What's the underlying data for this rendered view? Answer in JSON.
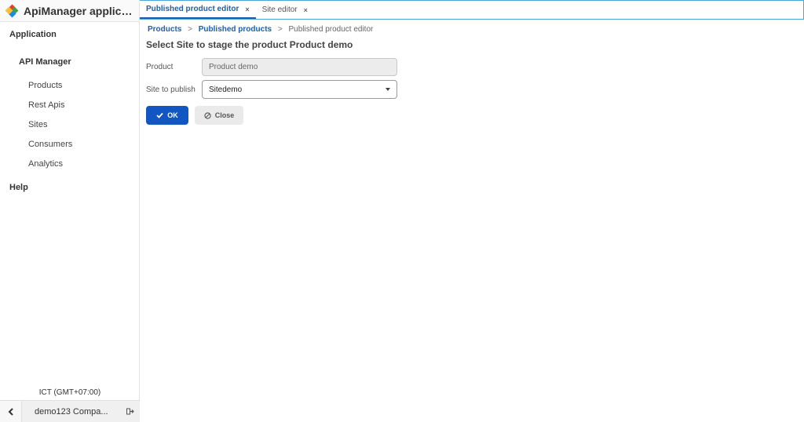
{
  "app": {
    "title": "ApiManager applicati...",
    "logo_colors": [
      "#e53935",
      "#43a047",
      "#1e88e5",
      "#fbc02d"
    ]
  },
  "sidebar": {
    "group_application": "Application",
    "group_api_manager": "API Manager",
    "items": [
      {
        "label": "Products"
      },
      {
        "label": "Rest Apis"
      },
      {
        "label": "Sites"
      },
      {
        "label": "Consumers"
      },
      {
        "label": "Analytics"
      }
    ],
    "group_help": "Help",
    "timezone": "ICT (GMT+07:00)",
    "company": "demo123 Compa...",
    "collapse_icon": "chevron-left-icon",
    "logout_icon": "logout-icon"
  },
  "tabs": [
    {
      "label": "Published product editor",
      "close": "×"
    },
    {
      "label": "Site editor",
      "close": "×"
    }
  ],
  "breadcrumb": {
    "products": "Products",
    "sep1": ">",
    "published_products": "Published products",
    "sep2": ">",
    "current": "Published product editor"
  },
  "form": {
    "title": "Select Site to stage the product Product demo",
    "product_label": "Product",
    "product_value": "Product demo",
    "site_label": "Site to publish",
    "site_value": "Sitedemo"
  },
  "buttons": {
    "ok_label": "OK",
    "close_label": "Close"
  },
  "colors": {
    "accent": "#1256c4",
    "tab_border": "#4aa8d8",
    "link": "#1f5fa8"
  }
}
